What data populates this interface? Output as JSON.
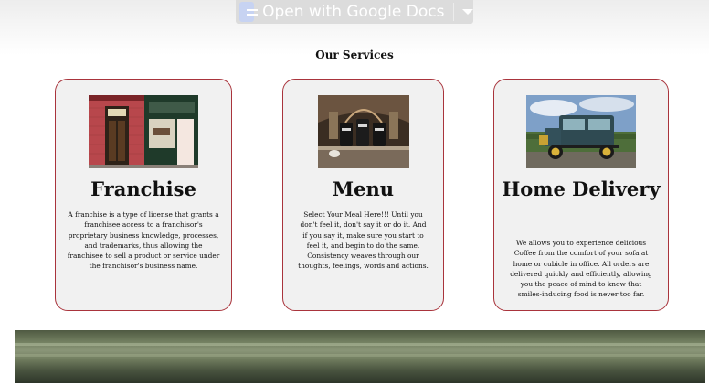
{
  "viewer_bar": {
    "open_label": "Open with Google Docs",
    "icon": "docs-icon",
    "caret_icon": "chevron-down-icon"
  },
  "services": {
    "title": "Our Services",
    "cards": [
      {
        "heading": "Franchise",
        "text": "A franchise is a type of license that grants a franchisee access to a franchisor's proprietary business knowledge, processes, and trademarks, thus allowing the franchisee to sell a product or service under the franchisor's business name.",
        "image": "storefront-photo"
      },
      {
        "heading": "Menu",
        "text": "Select Your Meal Here!!! Until you don't feel it, don't say it or do it. And if you say it, make sure you start to feel it, and begin to do the same. Consistency weaves through our thoughts, feelings, words and actions.",
        "image": "coffee-bar-photo"
      },
      {
        "heading": "Home Delivery",
        "text": "We allows you to experience delicious Coffee from the comfort of your sofa at home or cubicle in office. All orders are delivered quickly and efficiently, allowing you the peace of mind to know that smiles-inducing food is never too far.",
        "image": "delivery-truck-photo"
      }
    ]
  },
  "colors": {
    "card_border": "#a9343c",
    "card_background": "#f1f1f1"
  }
}
